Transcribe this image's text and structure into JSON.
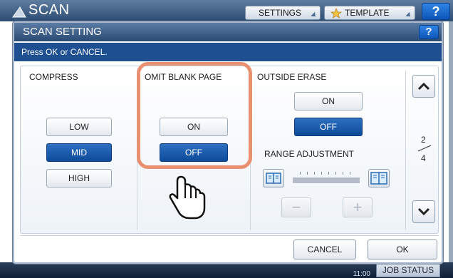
{
  "app": {
    "title": "SCAN"
  },
  "header": {
    "settings_label": "SETTINGS",
    "template_label": "TEMPLATE",
    "help_label": "?"
  },
  "dialog": {
    "title": "SCAN SETTING",
    "help_label": "?",
    "message": "Press OK or CANCEL."
  },
  "compress": {
    "label": "COMPRESS",
    "options": [
      "LOW",
      "MID",
      "HIGH"
    ],
    "selected": "MID"
  },
  "omit_blank_page": {
    "label": "OMIT BLANK PAGE",
    "options": [
      "ON",
      "OFF"
    ],
    "selected": "OFF"
  },
  "outside_erase": {
    "label": "OUTSIDE ERASE",
    "options": [
      "ON",
      "OFF"
    ],
    "selected": "OFF",
    "range_label": "RANGE ADJUSTMENT",
    "minus_label": "−",
    "plus_label": "+"
  },
  "pager": {
    "current": "2",
    "separator": "/",
    "total": "4"
  },
  "footer": {
    "cancel_label": "CANCEL",
    "ok_label": "OK"
  },
  "status_bar": {
    "time": "11:00",
    "job_status_label": "JOB STATUS"
  },
  "colors": {
    "selected_blue": "#0d4b9a",
    "highlight_orange": "#e99070",
    "title_bar": "#294a73"
  },
  "icons": [
    "scan-icon",
    "star-icon",
    "help-icon",
    "book-icon",
    "chevron-up-icon",
    "chevron-down-icon",
    "hand-pointer-icon"
  ]
}
